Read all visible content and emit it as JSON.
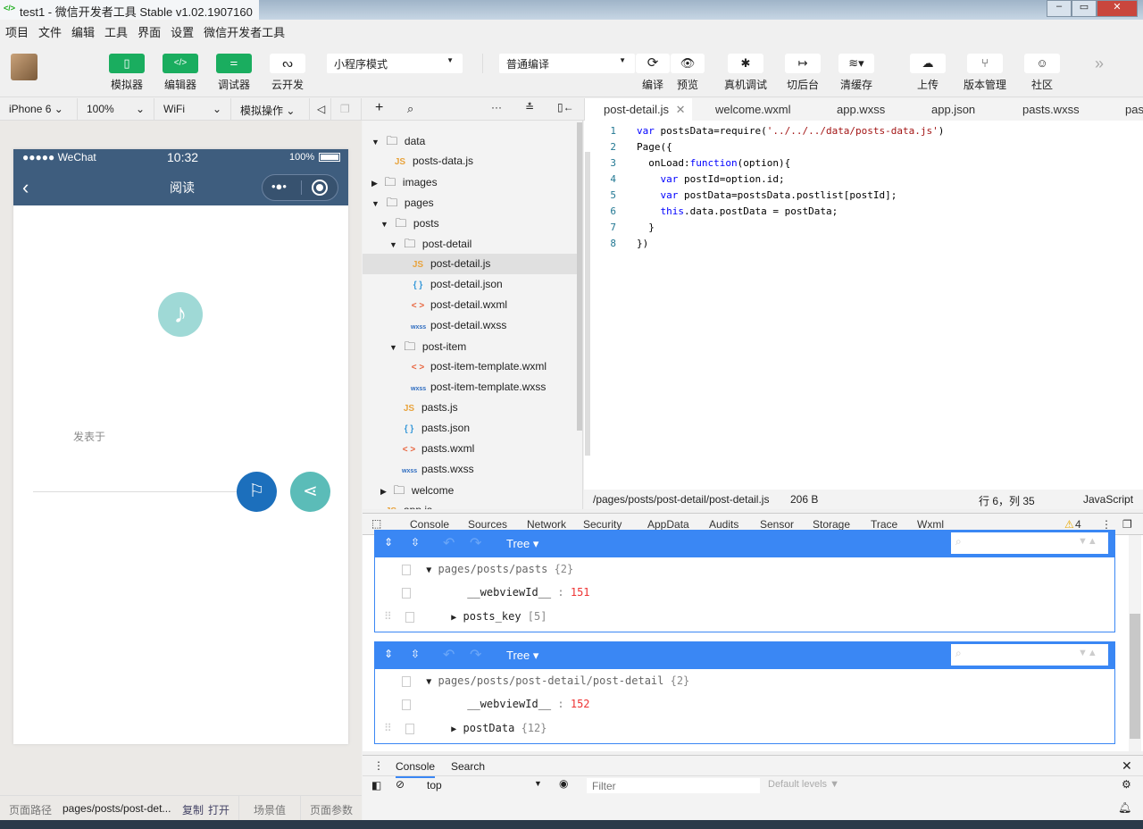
{
  "window": {
    "title": "test1 - 微信开发者工具 Stable v1.02.1907160"
  },
  "menu": [
    "项目",
    "文件",
    "编辑",
    "工具",
    "界面",
    "设置",
    "微信开发者工具"
  ],
  "toolbar": {
    "simulator": "模拟器",
    "editor": "编辑器",
    "debugger": "调试器",
    "cloud": "云开发",
    "mode": "小程序模式",
    "compile_mode": "普通编译",
    "compile": "编译",
    "preview": "预览",
    "remote_debug": "真机调试",
    "background": "切后台",
    "clear_cache": "清缓存",
    "upload": "上传",
    "version": "版本管理",
    "community": "社区"
  },
  "sim_bar": {
    "device": "iPhone 6",
    "zoom": "100%",
    "network": "WiFi",
    "ops": "模拟操作"
  },
  "phone": {
    "carrier": "●●●●● WeChat",
    "time": "10:32",
    "battery": "100%",
    "title": "阅读",
    "posted_at": "发表于"
  },
  "file_tree": [
    {
      "name": "data",
      "type": "folder",
      "open": true,
      "depth": 0
    },
    {
      "name": "posts-data.js",
      "type": "js",
      "depth": 1
    },
    {
      "name": "images",
      "type": "folder",
      "open": false,
      "depth": 0
    },
    {
      "name": "pages",
      "type": "folder",
      "open": true,
      "depth": 0
    },
    {
      "name": "posts",
      "type": "folder",
      "open": true,
      "depth": 1
    },
    {
      "name": "post-detail",
      "type": "folder",
      "open": true,
      "depth": 2
    },
    {
      "name": "post-detail.js",
      "type": "js",
      "depth": 3,
      "selected": true
    },
    {
      "name": "post-detail.json",
      "type": "json",
      "depth": 3
    },
    {
      "name": "post-detail.wxml",
      "type": "wxml",
      "depth": 3
    },
    {
      "name": "post-detail.wxss",
      "type": "wxss",
      "depth": 3
    },
    {
      "name": "post-item",
      "type": "folder",
      "open": true,
      "depth": 2
    },
    {
      "name": "post-item-template.wxml",
      "type": "wxml",
      "depth": 3
    },
    {
      "name": "post-item-template.wxss",
      "type": "wxss",
      "depth": 3
    },
    {
      "name": "pasts.js",
      "type": "js",
      "depth": 2
    },
    {
      "name": "pasts.json",
      "type": "json",
      "depth": 2
    },
    {
      "name": "pasts.wxml",
      "type": "wxml",
      "depth": 2
    },
    {
      "name": "pasts.wxss",
      "type": "wxss",
      "depth": 2
    },
    {
      "name": "welcome",
      "type": "folder",
      "open": false,
      "depth": 1
    },
    {
      "name": "app.js",
      "type": "js",
      "depth": 0
    }
  ],
  "editor_tabs": [
    "post-detail.js",
    "welcome.wxml",
    "app.wxss",
    "app.json",
    "pasts.wxss",
    "pas"
  ],
  "code": [
    "var postsData=require('../../../data/posts-data.js')",
    "Page({",
    "  onLoad:function(option){",
    "    var postId=option.id;",
    "    var postData=postsData.postlist[postId];",
    "    this.data.postData = postData;",
    "  }",
    "})"
  ],
  "status": {
    "path": "/pages/posts/post-detail/post-detail.js",
    "size": "206 B",
    "cursor": "行 6，列 35",
    "lang": "JavaScript"
  },
  "devtools": {
    "tabs": [
      "Console",
      "Sources",
      "Network",
      "Security",
      "AppData",
      "Audits",
      "Sensor",
      "Storage",
      "Trace",
      "Wxml"
    ],
    "active": "AppData",
    "warnings": "4"
  },
  "appdata": [
    {
      "view": "Tree",
      "root": "pages/posts/pasts",
      "root_count": "{2}",
      "webview_key": "__webviewId__",
      "webview_val": "151",
      "child": "posts_key",
      "child_count": "[5]"
    },
    {
      "view": "Tree",
      "root": "pages/posts/post-detail/post-detail",
      "root_count": "{2}",
      "webview_key": "__webviewId__",
      "webview_val": "152",
      "child": "postData",
      "child_count": "{12}"
    }
  ],
  "drawer": {
    "tabs": [
      "Console",
      "Search"
    ],
    "context": "top",
    "filter_placeholder": "Filter",
    "levels": "Default levels ▼"
  },
  "bottom": {
    "path_label": "页面路径",
    "path": "pages/posts/post-det...",
    "copy": "复制",
    "open": "打开",
    "scene": "场景值",
    "params": "页面参数"
  }
}
